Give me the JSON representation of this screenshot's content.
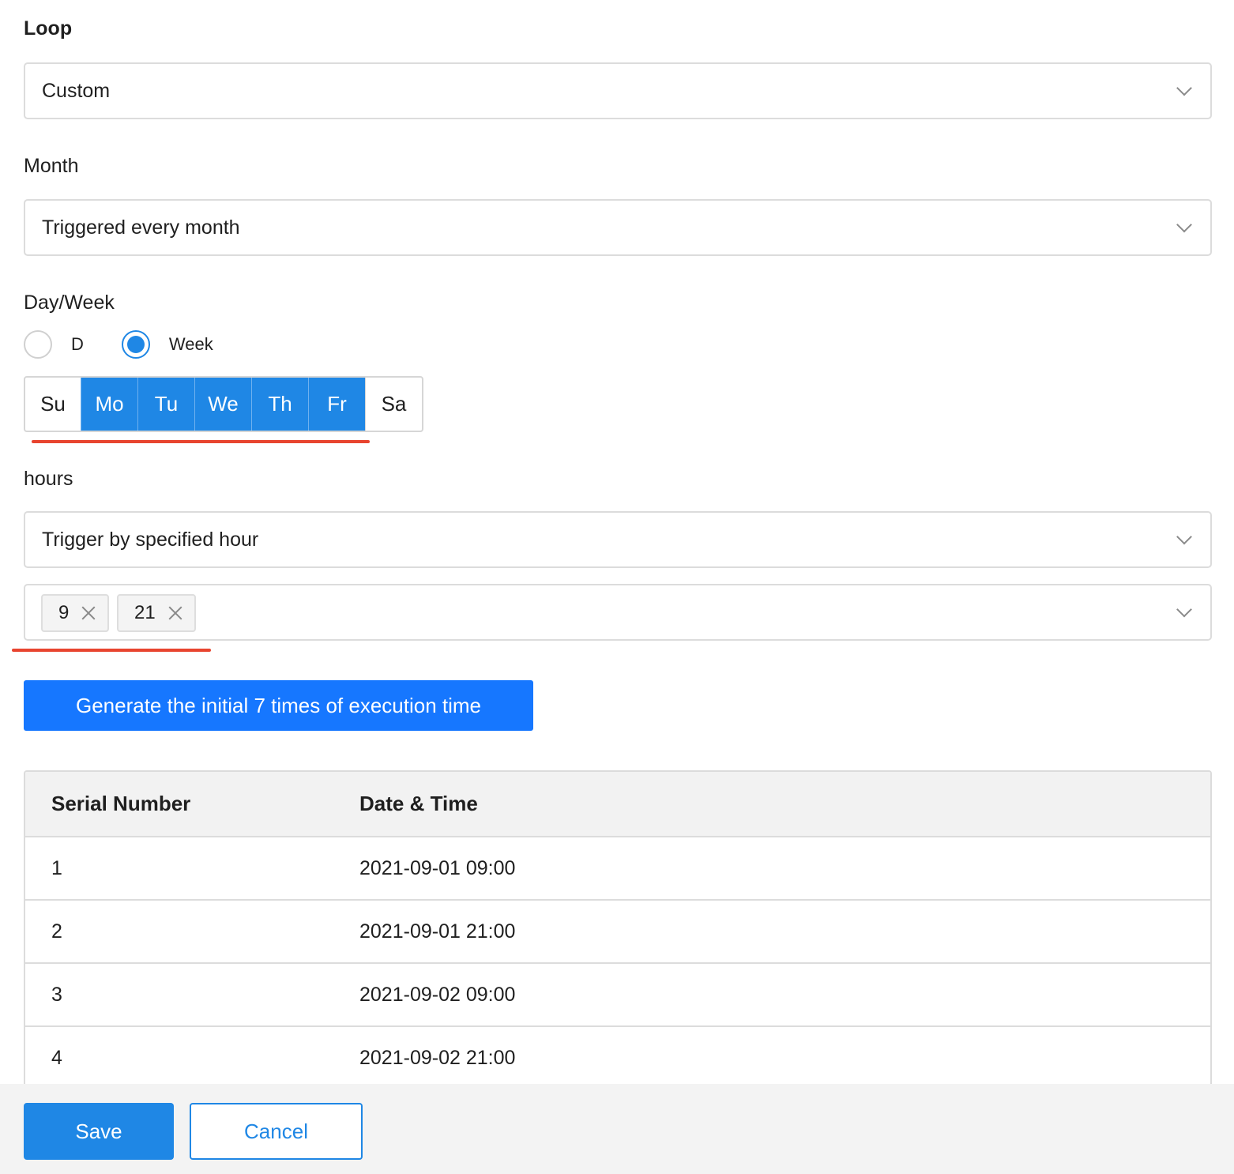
{
  "loop": {
    "label": "Loop",
    "value": "Custom"
  },
  "month": {
    "label": "Month",
    "value": "Triggered every month"
  },
  "dayweek": {
    "label": "Day/Week",
    "options": [
      {
        "label": "D",
        "checked": false
      },
      {
        "label": "Week",
        "checked": true
      }
    ],
    "days": [
      {
        "label": "Su",
        "selected": false
      },
      {
        "label": "Mo",
        "selected": true
      },
      {
        "label": "Tu",
        "selected": true
      },
      {
        "label": "We",
        "selected": true
      },
      {
        "label": "Th",
        "selected": true
      },
      {
        "label": "Fr",
        "selected": true
      },
      {
        "label": "Sa",
        "selected": false
      }
    ]
  },
  "hours": {
    "label": "hours",
    "mode": "Trigger by specified hour",
    "tags": [
      "9",
      "21"
    ]
  },
  "generate_button": "Generate the initial 7 times of execution time",
  "table": {
    "headers": [
      "Serial Number",
      "Date & Time"
    ],
    "rows": [
      [
        "1",
        "2021-09-01 09:00"
      ],
      [
        "2",
        "2021-09-01 21:00"
      ],
      [
        "3",
        "2021-09-02 09:00"
      ],
      [
        "4",
        "2021-09-02 21:00"
      ]
    ]
  },
  "footer": {
    "save": "Save",
    "cancel": "Cancel"
  },
  "colors": {
    "accent": "#1f87e5",
    "primary_button": "#1677ff",
    "annotation": "#e8442f"
  }
}
